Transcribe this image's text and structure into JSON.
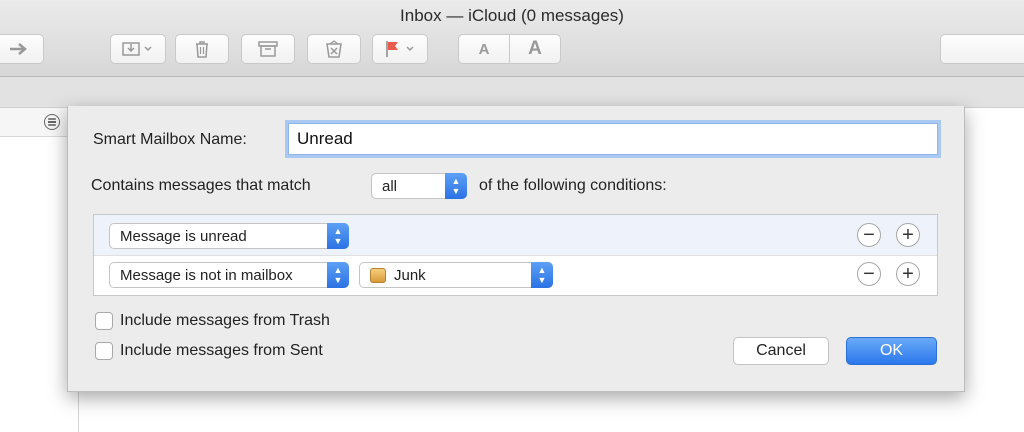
{
  "window": {
    "title": "Inbox — iCloud (0 messages)"
  },
  "toolbar": {
    "forward_icon": "arrow-right-icon",
    "font_small": "A",
    "font_large": "A",
    "flag_color": "#e95b4a"
  },
  "dialog": {
    "name_label": "Smart Mailbox Name:",
    "name_value": "Unread",
    "match_prefix": "Contains messages that match",
    "match_value": "all",
    "match_suffix": "of the following conditions:",
    "conditions": [
      {
        "criterion": "Message is unread"
      },
      {
        "criterion": "Message is not in mailbox",
        "mailbox": "Junk"
      }
    ],
    "include_trash": "Include messages from Trash",
    "include_sent": "Include messages from Sent",
    "cancel_label": "Cancel",
    "ok_label": "OK",
    "minus": "−",
    "plus": "+"
  },
  "colors": {
    "accent": "#2b78ed"
  }
}
